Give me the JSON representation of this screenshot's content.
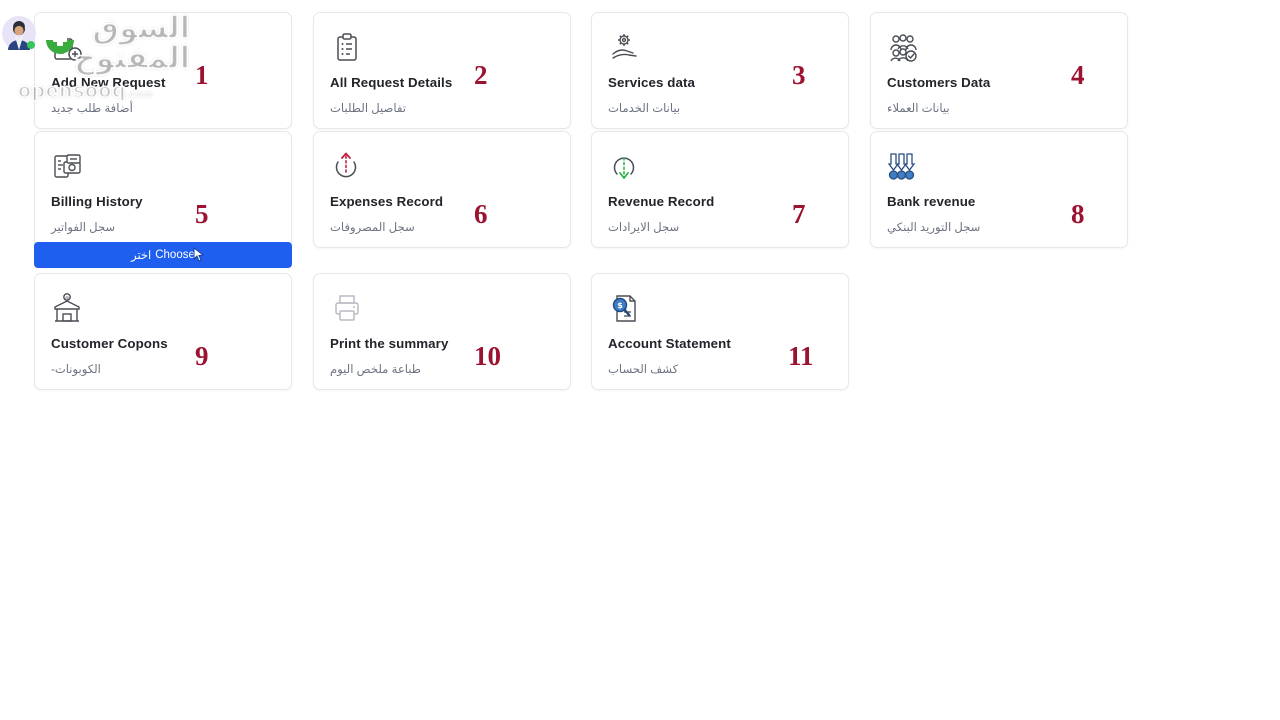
{
  "page": {
    "background_color": "#ffffff",
    "number_color": "#9c1231",
    "card_border_color": "#e8e8ec",
    "accent_blue": "#1f5ff0"
  },
  "avatar": {
    "name": "user-avatar",
    "status": "online",
    "status_color": "#35c759"
  },
  "watermark": {
    "arabic": "السوق المفتوح",
    "english": "opensooq",
    "domain_suffix": ".com",
    "badge": "green-check-badge"
  },
  "choose_button": {
    "label_en": "Choose",
    "label_ar": "اختر",
    "color": "#1f5ff0"
  },
  "cards": [
    {
      "number": "1",
      "title": "Add New Request",
      "subtitle": "أضافة طلب جديد",
      "icon": "add-request-icon"
    },
    {
      "number": "2",
      "title": "All Request Details",
      "subtitle": "تفاصيل الطلبات",
      "icon": "clipboard-list-icon"
    },
    {
      "number": "3",
      "title": "Services data",
      "subtitle": "بيانات الخدمات",
      "icon": "gear-hand-icon"
    },
    {
      "number": "4",
      "title": "Customers Data",
      "subtitle": "بيانات العملاء",
      "icon": "users-check-icon"
    },
    {
      "number": "5",
      "title": "Billing History",
      "subtitle": "سجل الفواتير",
      "icon": "invoice-money-icon"
    },
    {
      "number": "6",
      "title": "Expenses Record",
      "subtitle": "سجل المصروفات",
      "icon": "arrow-up-circle-icon"
    },
    {
      "number": "7",
      "title": "Revenue Record",
      "subtitle": "سجل الايرادات",
      "icon": "arrow-down-circle-icon"
    },
    {
      "number": "8",
      "title": "Bank revenue",
      "subtitle": "سجل التوريد البنكي",
      "icon": "bank-transfer-arrows-icon"
    },
    {
      "number": "9",
      "title": "Customer Copons",
      "subtitle": "الكوبونات-",
      "icon": "store-coupon-icon"
    },
    {
      "number": "10",
      "title": "Print the summary",
      "subtitle": "طباعة ملخص اليوم",
      "icon": "printer-icon"
    },
    {
      "number": "11",
      "title": "Account Statement",
      "subtitle": "كشف الحساب",
      "icon": "document-search-icon"
    }
  ]
}
